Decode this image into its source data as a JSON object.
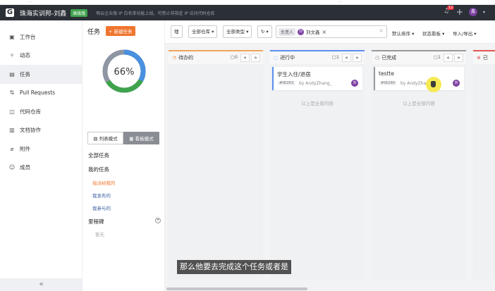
{
  "topstrip": {
    "left_text": "…",
    "right_text": "…"
  },
  "header": {
    "logo": "G",
    "title": "珠海实训邦-刘鑫",
    "badge": "高级版",
    "notice": "明云企业版 IP 白名单功能上线，可禁止非指定 IP 访问代码仓库",
    "notif_count": "12",
    "user_initial": "鑫"
  },
  "sidebar": {
    "items": [
      {
        "label": "工作台",
        "icon": "workbench-icon",
        "glyph": "▣"
      },
      {
        "label": "动态",
        "icon": "activity-icon",
        "glyph": "✧"
      },
      {
        "label": "任务",
        "icon": "task-icon",
        "glyph": "▤"
      },
      {
        "label": "Pull Requests",
        "icon": "pull-request-icon",
        "glyph": "⇅"
      },
      {
        "label": "代码仓库",
        "icon": "repo-icon",
        "glyph": "◫"
      },
      {
        "label": "文档协作",
        "icon": "doc-icon",
        "glyph": "▥"
      },
      {
        "label": "附件",
        "icon": "attachment-icon",
        "glyph": "⌀"
      },
      {
        "label": "成员",
        "icon": "members-icon",
        "glyph": "☺"
      }
    ],
    "collapse": "«"
  },
  "tasks_panel": {
    "title": "任务",
    "new_button": "+ 新建任务",
    "progress": "66%",
    "progress_value": 66,
    "donut_colors": {
      "blue": "#4a8fe0",
      "green": "#3fa34d",
      "gray": "#8f96a3"
    },
    "mode_list": "列表模式",
    "mode_board": "看板模式",
    "all_tasks": "全部任务",
    "my_tasks": "我的任务",
    "sub_items": [
      "指派给我的",
      "我发布的",
      "我参与的"
    ],
    "milestones": "里程碑",
    "milestones_empty": "暂无"
  },
  "toolbar": {
    "list_icon": "理",
    "repo_filter": "全部仓库",
    "type_filter": "全部类型",
    "history_icon": "↻",
    "assignee_label": "负责人",
    "assignee_initial": "刘",
    "assignee_name": "刘文鑫",
    "remove": "×",
    "clear": "×",
    "sort": "默认排序",
    "board_status": "状态看板",
    "import_export": "导入/导出"
  },
  "columns": [
    {
      "name": "待办的",
      "count": "0",
      "accent": "#f0a35e",
      "dot": "◔",
      "cards": [],
      "end_text": ""
    },
    {
      "name": "进行中",
      "count": "1",
      "accent": "#5b8ff0",
      "dot": "◌",
      "cards": [
        {
          "title": "学生入住/退宿",
          "id": "#I8283",
          "by": "by AndyZhang_",
          "avatar": "刘"
        }
      ],
      "end_text": "以上是全部内容"
    },
    {
      "name": "已完成",
      "count": "1",
      "accent": "#999999",
      "dot": "◷",
      "cards": [
        {
          "title": "testte",
          "id": "#I8290",
          "by": "by AndyZhang_",
          "avatar": "刘"
        }
      ],
      "end_text": "以上是全部内容"
    },
    {
      "name": "已",
      "count": "",
      "accent": "#e35555",
      "dot": "⊗",
      "cards": [],
      "end_text": ""
    }
  ],
  "subtitle": "那么他要去完成这个任务或者是"
}
